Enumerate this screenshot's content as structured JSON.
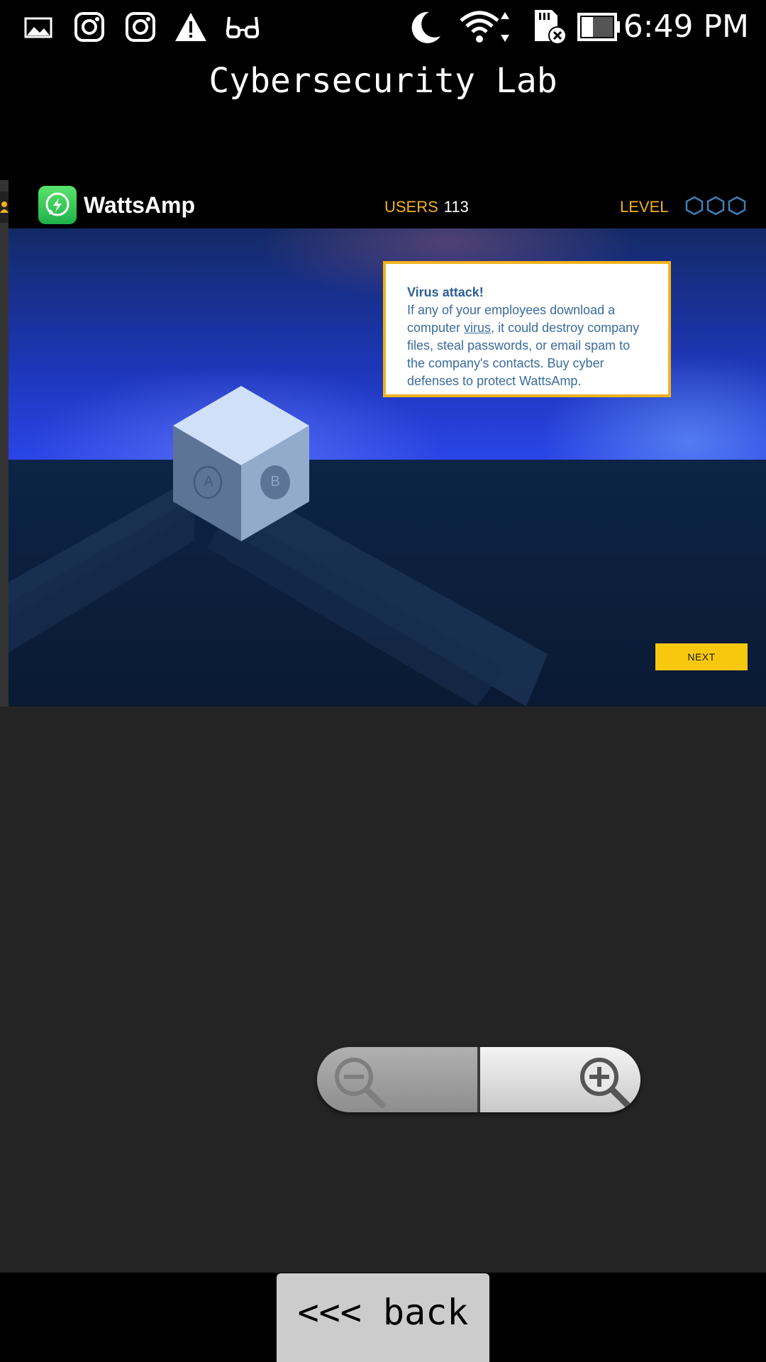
{
  "status_bar": {
    "time": "6:49 PM",
    "icons": [
      "image-icon",
      "instagram-icon",
      "instagram-icon",
      "warning-icon",
      "glasses-icon",
      "moon-icon",
      "wifi-icon",
      "sd-card-error-icon",
      "battery-icon"
    ]
  },
  "app": {
    "title": "Cybersecurity Lab"
  },
  "game": {
    "brand": "WattsAmp",
    "users_label": "USERS",
    "users_value": "113",
    "level_label": "LEVEL",
    "info": {
      "title": "Virus attack!",
      "body_before": "If any of your employees download a computer ",
      "link": "virus",
      "body_after": ", it could destroy company files, steal passwords, or email spam to the company's contacts. Buy cyber defenses to protect WattsAmp."
    },
    "cube_face_a": "A",
    "cube_face_b": "B",
    "next_label": "NEXT"
  },
  "controls": {
    "back_label": "<<< back"
  },
  "colors": {
    "accent_yellow": "#f2b21c",
    "next_yellow": "#f8c80e",
    "brand_green": "#25d366"
  }
}
